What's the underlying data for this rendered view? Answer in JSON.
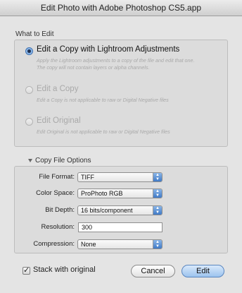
{
  "window": {
    "title": "Edit Photo with Adobe Photoshop CS5.app"
  },
  "edit_group": {
    "label": "What to Edit",
    "options": [
      {
        "label": "Edit a Copy with Lightroom Adjustments",
        "description": "Apply the Lightroom adjustments to a copy of the file and edit that one. The copy will not contain layers or alpha channels.",
        "selected": true,
        "enabled": true
      },
      {
        "label": "Edit a Copy",
        "description": "Edit a Copy is not applicable to raw or Digital Negative files",
        "selected": false,
        "enabled": false
      },
      {
        "label": "Edit Original",
        "description": "Edit Original is not applicable to raw or Digital Negative files",
        "selected": false,
        "enabled": false
      }
    ]
  },
  "copy_options": {
    "label": "Copy File Options",
    "file_format": {
      "label": "File Format:",
      "value": "TIFF"
    },
    "color_space": {
      "label": "Color Space:",
      "value": "ProPhoto RGB"
    },
    "bit_depth": {
      "label": "Bit Depth:",
      "value": "16 bits/component"
    },
    "resolution": {
      "label": "Resolution:",
      "value": "300"
    },
    "compression": {
      "label": "Compression:",
      "value": "None"
    }
  },
  "stack": {
    "label": "Stack with original",
    "checked": true
  },
  "buttons": {
    "cancel": "Cancel",
    "edit": "Edit"
  }
}
